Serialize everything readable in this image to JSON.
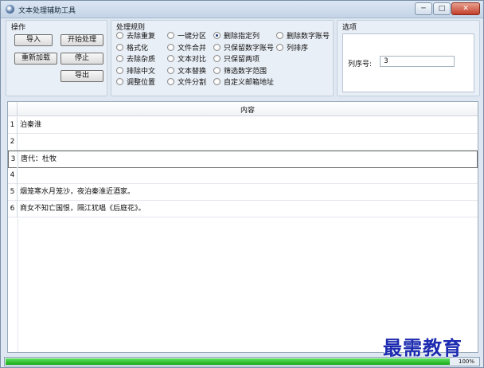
{
  "window": {
    "title": "文本处理辅助工具",
    "min": "─",
    "max": "□",
    "close": "✕"
  },
  "ops": {
    "title": "操作",
    "import": "导入",
    "start": "开始处理",
    "reload": "重新加载",
    "stop": "停止",
    "export": "导出"
  },
  "rules": {
    "title": "处理规则",
    "items": [
      {
        "label": "去除重复",
        "checked": false
      },
      {
        "label": "格式化",
        "checked": false
      },
      {
        "label": "去除杂质",
        "checked": false
      },
      {
        "label": "排除中文",
        "checked": false
      },
      {
        "label": "调整位置",
        "checked": false
      },
      {
        "label": "一键分区",
        "checked": false
      },
      {
        "label": "文件合并",
        "checked": false
      },
      {
        "label": "文本对比",
        "checked": false
      },
      {
        "label": "文本替换",
        "checked": false
      },
      {
        "label": "文件分割",
        "checked": false
      },
      {
        "label": "删除指定列",
        "checked": true
      },
      {
        "label": "只保留数字账号",
        "checked": false
      },
      {
        "label": "只保留两项",
        "checked": false
      },
      {
        "label": "筛选数字范围",
        "checked": false
      },
      {
        "label": "自定义邮箱地址",
        "checked": false
      },
      {
        "label": "删除数字账号",
        "checked": false
      },
      {
        "label": "列排序",
        "checked": false
      }
    ]
  },
  "options": {
    "title": "选项",
    "col_label": "列序号:",
    "col_value": "3"
  },
  "grid": {
    "header": "内容",
    "rows": [
      {
        "n": "1",
        "text": "泊秦淮"
      },
      {
        "n": "2",
        "text": ""
      },
      {
        "n": "3",
        "text": "唐代：杜牧"
      },
      {
        "n": "4",
        "text": ""
      },
      {
        "n": "5",
        "text": "烟笼寒水月笼沙，夜泊秦淮近酒家。"
      },
      {
        "n": "6",
        "text": "商女不知亡国恨，隔江犹唱《后庭花》。"
      }
    ]
  },
  "status": {
    "progress": 1.0,
    "progress_text": "100%"
  },
  "watermark": "最需教育",
  "colors": {
    "progress": "#18a818",
    "watermark": "#1c2bb0"
  }
}
